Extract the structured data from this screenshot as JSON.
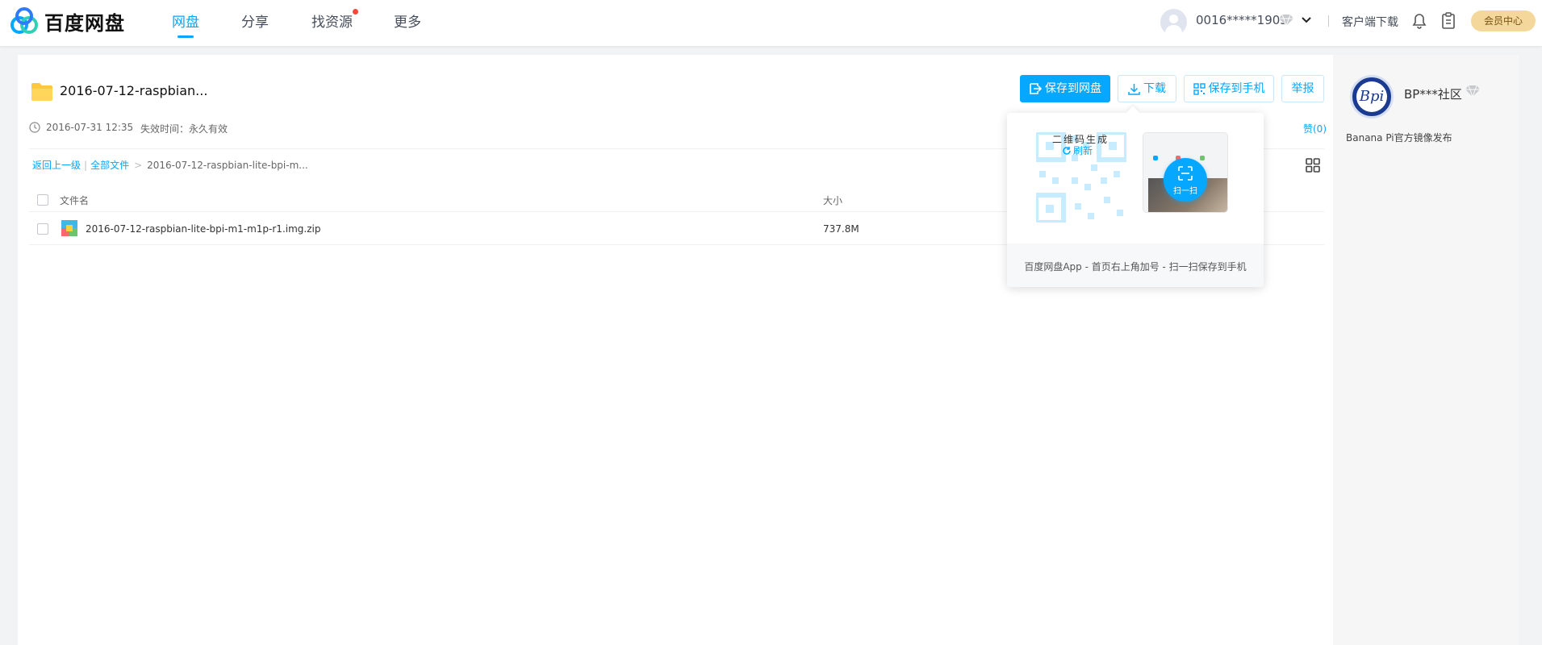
{
  "header": {
    "logo_text": "百度网盘",
    "nav": [
      "网盘",
      "分享",
      "找资源",
      "更多"
    ],
    "username": "0016*****1903",
    "client_download": "客户端下载",
    "member_center": "会员中心"
  },
  "share": {
    "title": "2016-07-12-raspbian...",
    "buttons": {
      "save": "保存到网盘",
      "download": "下载",
      "save_phone": "保存到手机",
      "report": "举报"
    },
    "create_time": "2016-07-31 12:35",
    "expire": "失效时间：永久有效",
    "like": "赞(0)"
  },
  "breadcrumb": {
    "back": "返回上一级",
    "all": "全部文件",
    "current": "2016-07-12-raspbian-lite-bpi-m..."
  },
  "table": {
    "headers": {
      "name": "文件名",
      "size": "大小"
    },
    "rows": [
      {
        "name": "2016-07-12-raspbian-lite-bpi-m1-m1p-r1.img.zip",
        "size": "737.8M"
      }
    ]
  },
  "popup": {
    "qr_generating": "二维码生成",
    "refresh": "刷新",
    "scan": "扫一扫",
    "footer": "百度网盘App - 首页右上角加号 - 扫一扫保存到手机"
  },
  "profile": {
    "name": "BP***社区",
    "description": "Banana Pi官方镜像发布"
  },
  "colors": {
    "accent": "#06a7ff",
    "member": "#f4d89b",
    "folder": "#ffc73d"
  }
}
